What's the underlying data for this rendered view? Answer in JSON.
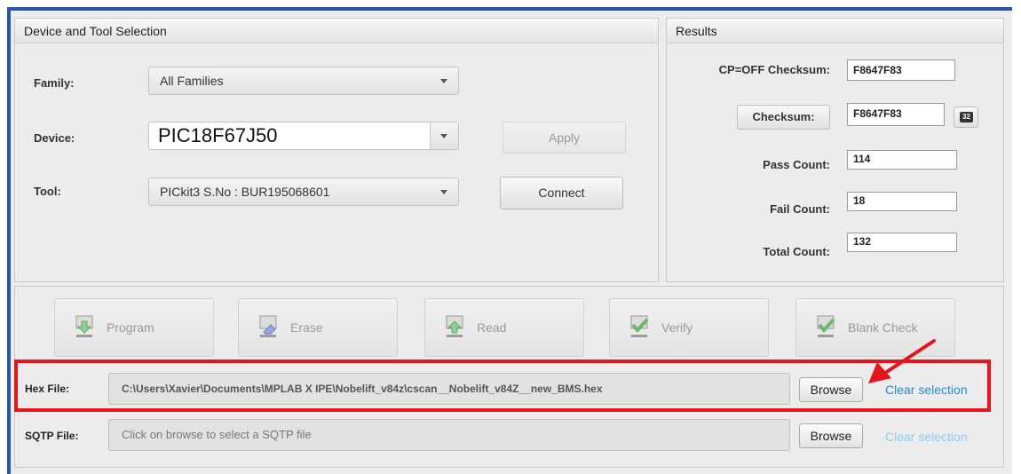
{
  "device_panel": {
    "title": "Device and Tool Selection",
    "family_label": "Family:",
    "family_value": "All Families",
    "device_label": "Device:",
    "device_value": "PIC18F67J50",
    "tool_label": "Tool:",
    "tool_value": "PICkit3 S.No : BUR195068601",
    "apply_label": "Apply",
    "connect_label": "Connect"
  },
  "results_panel": {
    "title": "Results",
    "cp_off_label": "CP=OFF Checksum:",
    "cp_off_value": "F8647F83",
    "checksum_button": "Checksum:",
    "checksum_value": "F8647F83",
    "bits_badge": "32",
    "pass_label": "Pass Count:",
    "pass_value": "114",
    "fail_label": "Fail Count:",
    "fail_value": "18",
    "total_label": "Total Count:",
    "total_value": "132"
  },
  "actions": {
    "program": "Program",
    "erase": "Erase",
    "read": "Read",
    "verify": "Verify",
    "blank_check": "Blank Check"
  },
  "hex_file": {
    "label": "Hex File:",
    "path": "C:\\Users\\Xavier\\Documents\\MPLAB X IPE\\Nobelift_v84z\\cscan__Nobelift_v84Z__new_BMS.hex",
    "browse": "Browse",
    "clear": "Clear selection"
  },
  "sqtp_file": {
    "label": "SQTP File:",
    "placeholder": "Click on browse to select a SQTP file",
    "browse": "Browse",
    "clear": "Clear selection"
  },
  "colors": {
    "highlight": "#e8141c",
    "link_active": "#1a8fd6",
    "link_disabled": "#8fcde9",
    "frame": "#2a56a6"
  }
}
